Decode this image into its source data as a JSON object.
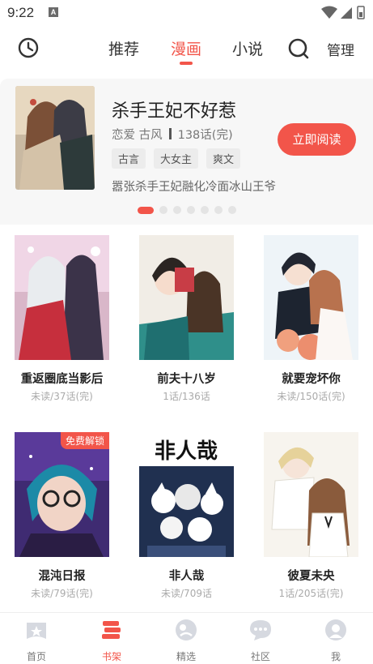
{
  "status": {
    "time": "9:22",
    "app_badge": "A"
  },
  "nav": {
    "tabs": [
      {
        "label": "推荐",
        "active": false
      },
      {
        "label": "漫画",
        "active": true
      },
      {
        "label": "小说",
        "active": false
      }
    ],
    "manage_label": "管理",
    "accent_color": "#f2554a"
  },
  "banner": {
    "title": "杀手王妃不好惹",
    "genres": "恋爱 古风",
    "chapters": "138话(完)",
    "tags": [
      "古言",
      "大女主",
      "爽文"
    ],
    "description": "嚣张杀手王妃融化冷面冰山王爷",
    "read_button": "立即阅读",
    "slide_count": 7,
    "active_slide": 0
  },
  "comics": [
    {
      "title": "重返圈底当影后",
      "progress": "未读/37话(完)",
      "free": false
    },
    {
      "title": "前夫十八岁",
      "progress": "1话/136话",
      "free": false
    },
    {
      "title": "就要宠坏你",
      "progress": "未读/150话(完)",
      "free": false
    },
    {
      "title": "混沌日报",
      "progress": "未读/79话(完)",
      "free": true,
      "badge": "免费解锁"
    },
    {
      "title": "非人哉",
      "progress": "未读/709话",
      "free": false,
      "cover_text": "非人哉"
    },
    {
      "title": "彼夏未央",
      "progress": "1话/205话(完)",
      "free": false
    }
  ],
  "bottom_nav": [
    {
      "label": "首页",
      "icon": "home-icon",
      "active": false
    },
    {
      "label": "书架",
      "icon": "bookshelf-icon",
      "active": true
    },
    {
      "label": "精选",
      "icon": "featured-icon",
      "active": false
    },
    {
      "label": "社区",
      "icon": "community-icon",
      "active": false
    },
    {
      "label": "我",
      "icon": "profile-icon",
      "active": false
    }
  ]
}
